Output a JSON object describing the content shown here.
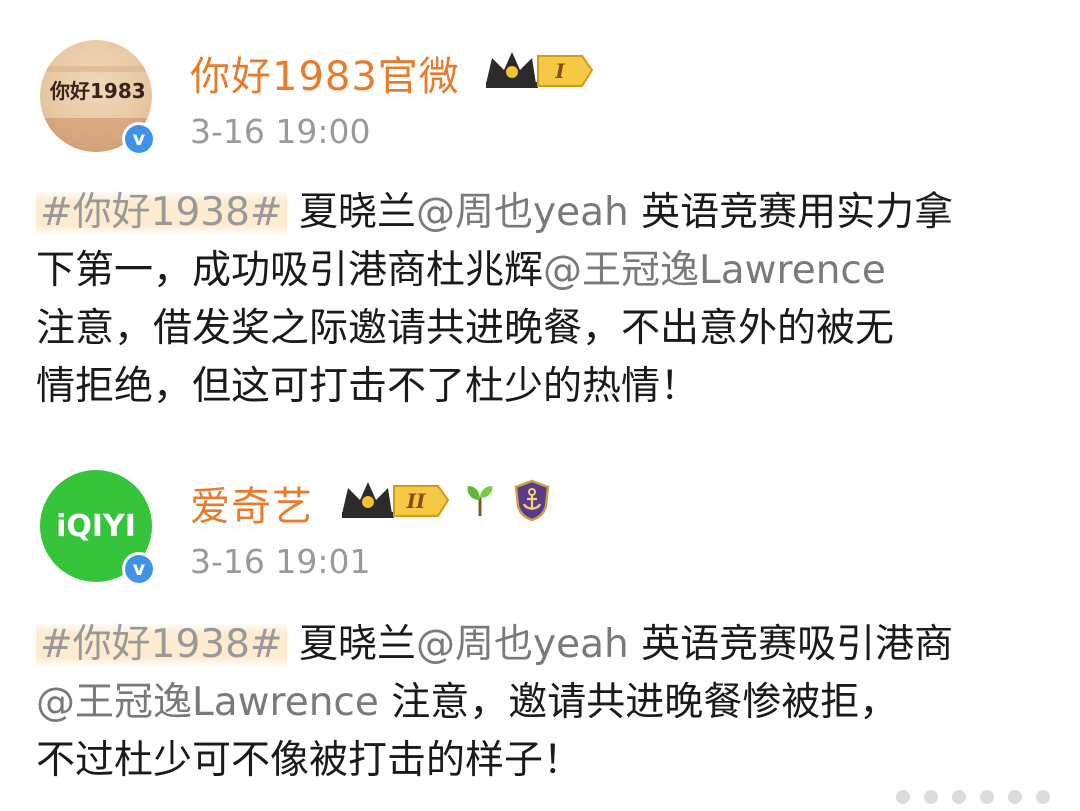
{
  "posts": [
    {
      "account_name": "你好1983官微",
      "avatar_text": "你好1983",
      "time": "3-16 19:00",
      "vip_level": "I",
      "hashtag": "#你好1938#",
      "lines": [
        [
          "夏晓兰",
          "@周也yeah",
          "英语竞赛用实力拿"
        ],
        [
          "下第一，成功吸引港商杜兆辉",
          "@王冠逸Lawrence"
        ],
        [
          "注意，借发奖之际邀请共进晚餐，不出意外的被无"
        ],
        [
          "情拒绝，但这可打击不了杜少的热情！"
        ]
      ]
    },
    {
      "account_name": "爱奇艺",
      "avatar_text": "iQIYI",
      "time": "3-16 19:01",
      "vip_level": "II",
      "hashtag": "#你好1938#",
      "lines": [
        [
          "夏晓兰",
          "@周也yeah",
          "英语竞赛吸引港商"
        ],
        [
          "@王冠逸Lawrence",
          "注意，邀请共进晚餐惨被拒，"
        ],
        [
          "不过杜少可不像被打击的样子！"
        ]
      ]
    }
  ],
  "icons": [
    "crown-badge-icon",
    "verified-v-icon",
    "sprout-icon",
    "shield-anchor-icon"
  ],
  "colors": {
    "name": "#e77d2c",
    "time": "#9a9a9a",
    "hashtag_highlight": "#fde8c8",
    "verified": "#3e93e8",
    "iqiyi_green": "#36c53a"
  }
}
